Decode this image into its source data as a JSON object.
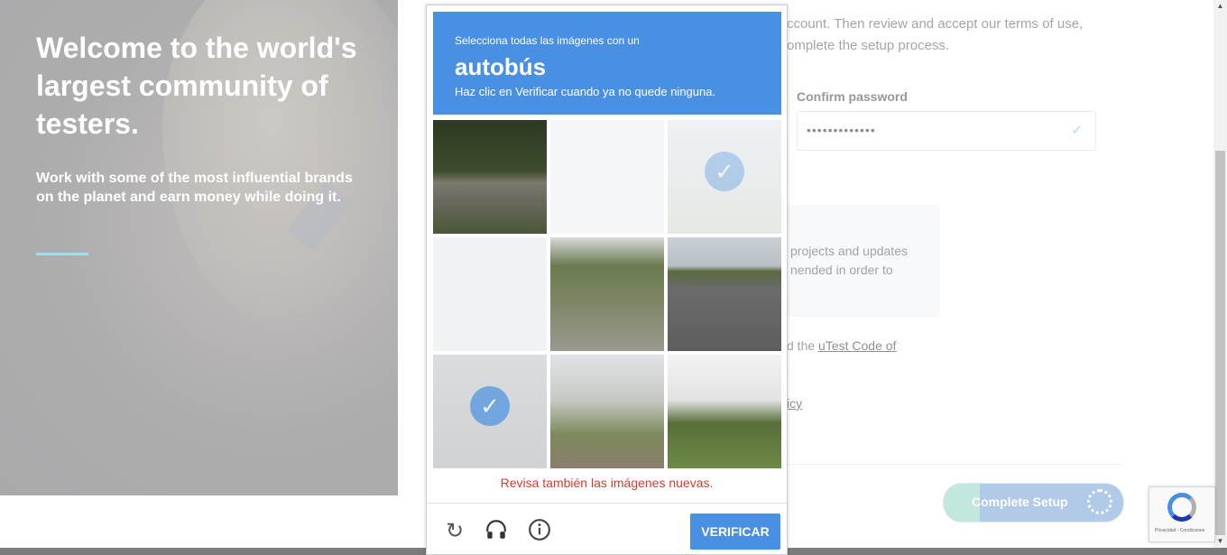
{
  "hero": {
    "title": "Welcome to the world's largest community of testers.",
    "subtitle": "Work with some of the most influential brands on the planet and earn money while doing it."
  },
  "form": {
    "intro_line1": "ccount. Then review and accept our terms of use,",
    "intro_line2": "omplete the setup process.",
    "confirm_label": "Confirm password",
    "confirm_value": "•••••••••••••",
    "info_line1": "projects and updates",
    "info_line2": "nended in order to",
    "code_text": "d the ",
    "code_link": "uTest Code of",
    "policy_link": "icy",
    "complete_button": "Complete Setup"
  },
  "captcha": {
    "instruction_line1": "Selecciona todas las imágenes con un",
    "target_word": "autobús",
    "instruction_line3": "Haz clic en Verificar cuando ya no quede ninguna.",
    "warning": "Revisa también las imágenes nuevas.",
    "verify_button": "VERIFICAR",
    "tiles": [
      {
        "selected": false,
        "desc": "street-car"
      },
      {
        "selected": false,
        "desc": "blank"
      },
      {
        "selected": true,
        "desc": "faded"
      },
      {
        "selected": false,
        "desc": "blank"
      },
      {
        "selected": false,
        "desc": "trees"
      },
      {
        "selected": false,
        "desc": "road"
      },
      {
        "selected": true,
        "desc": "faded-bus"
      },
      {
        "selected": false,
        "desc": "intersection"
      },
      {
        "selected": false,
        "desc": "car-lawn"
      }
    ]
  },
  "badge": {
    "text": "Privacidad - Condiciones"
  }
}
